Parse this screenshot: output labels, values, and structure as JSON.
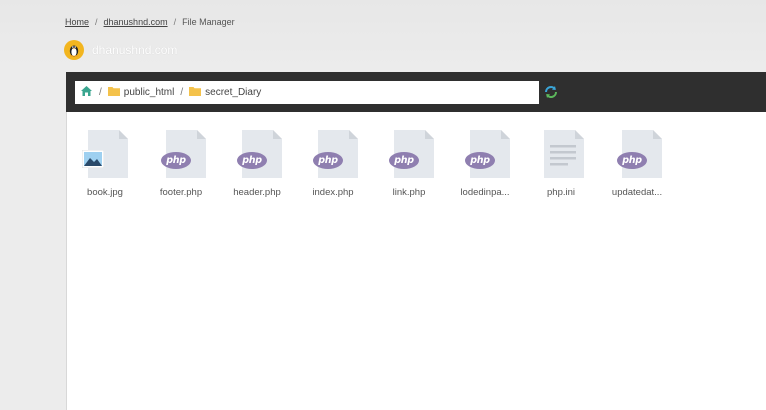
{
  "breadcrumb": {
    "home": "Home",
    "domain": "dhanushnd.com",
    "current": "File Manager"
  },
  "site": {
    "name": "dhanushnd.com"
  },
  "path": {
    "segments": [
      "public_html",
      "secret_Diary"
    ]
  },
  "files": [
    {
      "name": "book.jpg",
      "type": "image"
    },
    {
      "name": "footer.php",
      "type": "php"
    },
    {
      "name": "header.php",
      "type": "php"
    },
    {
      "name": "index.php",
      "type": "php"
    },
    {
      "name": "link.php",
      "type": "php"
    },
    {
      "name": "lodedinpa...",
      "type": "php"
    },
    {
      "name": "php.ini",
      "type": "text"
    },
    {
      "name": "updatedat...",
      "type": "php"
    }
  ],
  "icons": {
    "php_badge": "php"
  },
  "colors": {
    "toolbar": "#2f2f2f",
    "avatar": "#f2b51f",
    "php_badge": "#8f7fb0",
    "folder": "#f4c24b"
  }
}
